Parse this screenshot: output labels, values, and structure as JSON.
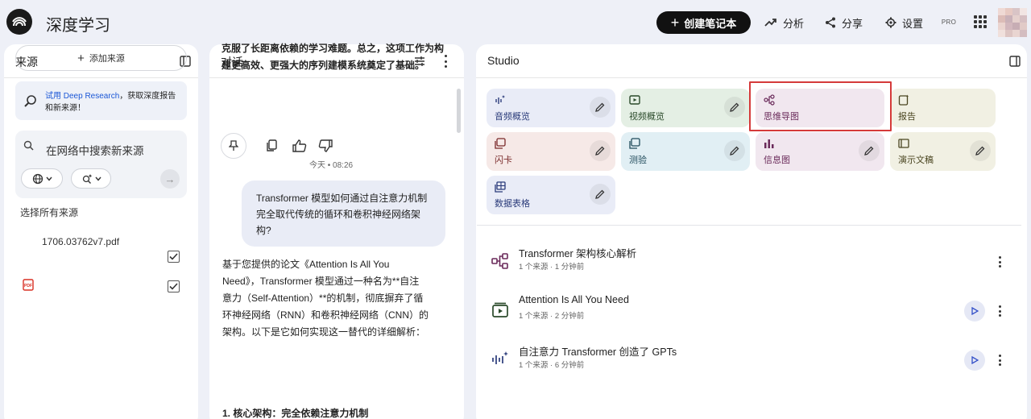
{
  "app": {
    "title": "深度学习"
  },
  "topbar": {
    "create_label": "创建笔记本",
    "analytics_label": "分析",
    "share_label": "分享",
    "settings_label": "设置",
    "pro_label": "PRO"
  },
  "sources": {
    "title": "来源",
    "add_label": "添加来源",
    "promo_link": "试用 Deep Research",
    "promo_text": "，获取深度报告和新来源！",
    "search_placeholder": "在网络中搜索新来源",
    "select_all_label": "选择所有来源",
    "files": [
      {
        "name": "1706.03762v7.pdf",
        "checked": true
      }
    ]
  },
  "chat": {
    "title": "对话",
    "prev_answer_tail": "克服了长距离依赖的学习难题。总之，这项工作为构建更高效、更强大的序列建模系统奠定了基础。",
    "timestamp": "今天 • 08:26",
    "user_message": "Transformer 模型如何通过自注意力机制完全取代传统的循环和卷积神经网络架构?",
    "answer": "基于您提供的论文《Attention Is All You Need》，Transformer 模型通过一种名为**自注意力（Self-Attention）**的机制，彻底摒弃了循环神经网络（RNN）和卷积神经网络（CNN）的架构。以下是它如何实现这一替代的详细解析：",
    "answer_next": "1. 核心架构：完全依赖注意力机制"
  },
  "studio": {
    "title": "Studio",
    "tiles": [
      {
        "label": "音频概览",
        "bg": "#e9ecf7",
        "fg": "#2a3b7a"
      },
      {
        "label": "视频概览",
        "bg": "#e4efe4",
        "fg": "#2a4a2a"
      },
      {
        "label": "思维导图",
        "bg": "#f1e7ef",
        "fg": "#6a2a5a"
      },
      {
        "label": "报告",
        "bg": "#f1f0e3",
        "fg": "#4a4520"
      },
      {
        "label": "闪卡",
        "bg": "#f6e9e7",
        "fg": "#7a2a2a"
      },
      {
        "label": "测验",
        "bg": "#e1eff4",
        "fg": "#1f4a5a"
      },
      {
        "label": "信息图",
        "bg": "#f1e7ef",
        "fg": "#6a2a5a"
      },
      {
        "label": "演示文稿",
        "bg": "#f1f0e3",
        "fg": "#4a4520"
      },
      {
        "label": "数据表格",
        "bg": "#e9ecf7",
        "fg": "#2a3b7a"
      }
    ],
    "notes": [
      {
        "title": "Transformer 架构核心解析",
        "meta": "1 个来源 · 1 分钟前",
        "icon": "mind-map-icon",
        "playable": false
      },
      {
        "title": "Attention Is All You Need",
        "meta": "1 个来源 · 2 分钟前",
        "icon": "video-icon",
        "playable": true
      },
      {
        "title": "自注意力 Transformer 创造了 GPTs",
        "meta": "1 个来源 · 6 分钟前",
        "icon": "audio-wave-icon",
        "playable": true
      }
    ]
  }
}
